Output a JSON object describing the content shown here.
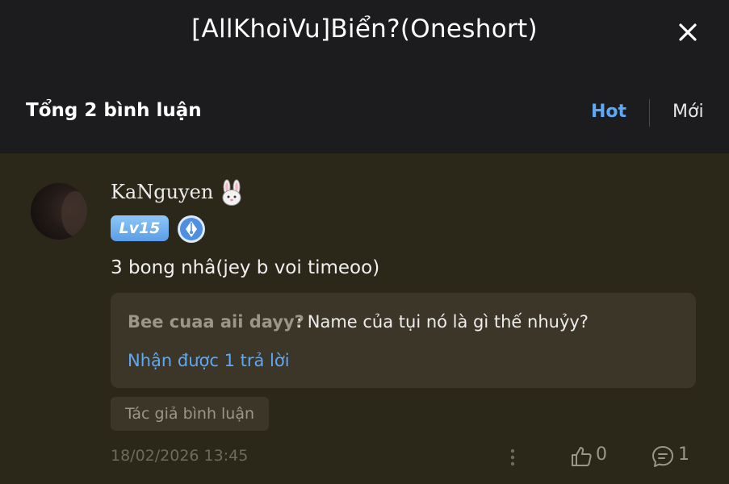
{
  "header": {
    "title": "[AllKhoiVu]Biển?(Oneshort)",
    "close_icon": "close-icon"
  },
  "comments_bar": {
    "total": "Tổng 2 bình luận",
    "sort_hot": "Hot",
    "sort_new": "Mới",
    "accent_color": "#5fa8f5"
  },
  "comment": {
    "username": "KaNguyen",
    "username_emoji": "rabbit-face-icon",
    "level": "Lv15",
    "badge_icon": "fountain-pen-icon",
    "content": "3 bong nhâ(jey b voi timeoo)",
    "reply_preview": {
      "author": "Bee cuaa aii dayy?",
      "text": ": Name của tụi nó là gì thế nhuỷy?",
      "reply_count_text": "Nhận được 1 trả lời"
    },
    "author_tag": "Tác giả bình luận",
    "timestamp": "18/02/2026 13:45",
    "likes": "0",
    "replies": "1",
    "background_color": "#2b2719"
  }
}
